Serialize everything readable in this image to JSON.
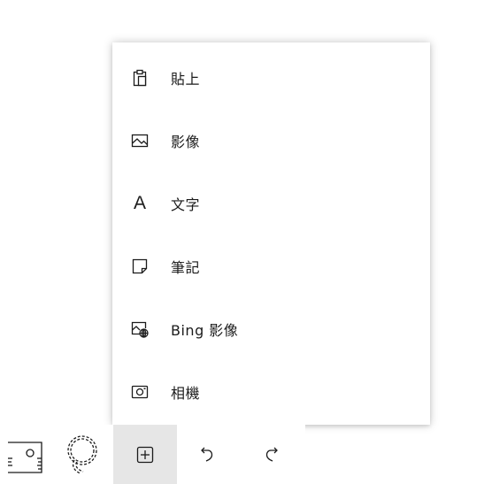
{
  "insert_menu": {
    "items": [
      {
        "label": "貼上",
        "icon": "paste-icon"
      },
      {
        "label": "影像",
        "icon": "image-icon"
      },
      {
        "label": "文字",
        "icon": "text-icon",
        "icon_glyph": "A"
      },
      {
        "label": "筆記",
        "icon": "note-icon"
      },
      {
        "label": "Bing 影像",
        "icon": "bing-image-icon"
      },
      {
        "label": "相機",
        "icon": "camera-icon"
      }
    ]
  },
  "toolbar": {
    "tools": [
      {
        "icon": "ruler-icon"
      },
      {
        "icon": "lasso-icon"
      },
      {
        "icon": "add-icon",
        "active": true
      },
      {
        "icon": "undo-icon"
      },
      {
        "icon": "redo-icon"
      }
    ]
  },
  "colors": {
    "text": "#1b1b1b",
    "active_tool_bg": "#e6e6e6",
    "menu_bg": "#ffffff"
  }
}
